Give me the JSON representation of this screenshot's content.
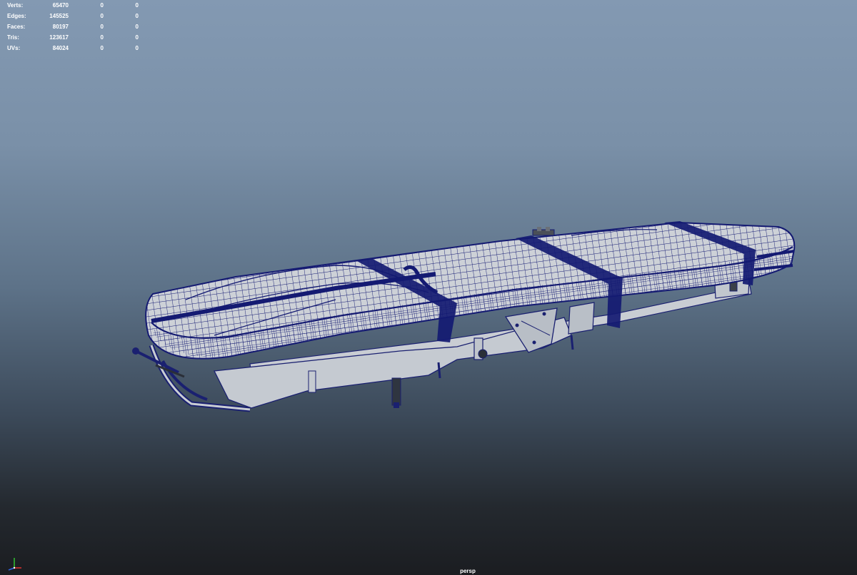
{
  "heads_up_display": {
    "rows": [
      {
        "label": "Verts:",
        "values": [
          "65470",
          "0",
          "0"
        ]
      },
      {
        "label": "Edges:",
        "values": [
          "145525",
          "0",
          "0"
        ]
      },
      {
        "label": "Faces:",
        "values": [
          "80197",
          "0",
          "0"
        ]
      },
      {
        "label": "Tris:",
        "values": [
          "123617",
          "0",
          "0"
        ]
      },
      {
        "label": "UVs:",
        "values": [
          "84024",
          "0",
          "0"
        ]
      }
    ]
  },
  "viewport": {
    "camera": "persp",
    "display_mode": "wireframe-on-shaded"
  },
  "colors": {
    "wireframe": "#141a72",
    "shaded_surface": "#c8cdd4",
    "hud_text": "#ffffff",
    "axis_x": "#e03030",
    "axis_y": "#30c030",
    "axis_z": "#3060e0"
  },
  "axis_gizmo": {
    "icon": "axis-gizmo-icon"
  }
}
